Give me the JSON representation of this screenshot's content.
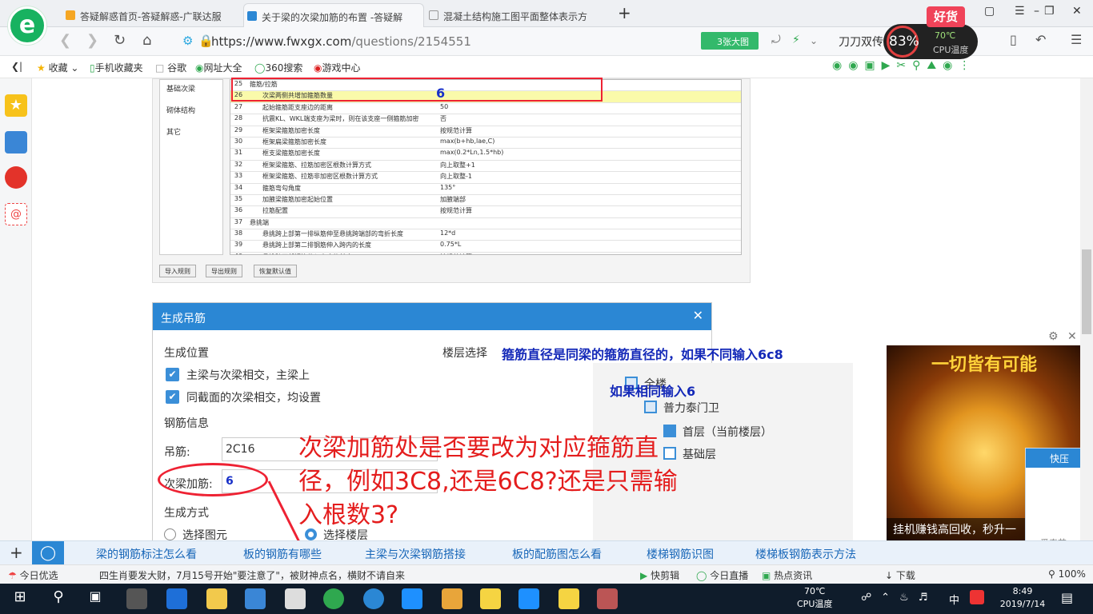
{
  "tabs": [
    {
      "label": "答疑解惑首页-答疑解惑-广联达服",
      "active": false
    },
    {
      "label": "关于梁的次梁加筋的布置 -答疑解",
      "active": true
    },
    {
      "label": "混凝土结构施工图平面整体表示方",
      "active": false
    }
  ],
  "window": {
    "new_tab": "+"
  },
  "hot_badge": "好货",
  "cpu": {
    "percent": "83%",
    "temp": "70℃",
    "label": "CPU温度"
  },
  "address": {
    "host": "https://www.fwxgx.com",
    "path": "/questions/2154551",
    "big_image_button": "3张大图",
    "search_hint": "刀刀双传"
  },
  "bookmarks": [
    "收藏",
    "手机收藏夹",
    "谷歌",
    "网址大全",
    "360搜索",
    "游戏中心"
  ],
  "doc": {
    "left_items": [
      "基础次梁",
      "砌体结构",
      "其它"
    ],
    "rows": [
      {
        "n": "25",
        "k": "箍筋/拉筋",
        "v": "",
        "group": true
      },
      {
        "n": "26",
        "k": "次梁两侧共增加箍筋数量",
        "v": "",
        "highlight": true
      },
      {
        "n": "27",
        "k": "起始箍筋距支座边的距离",
        "v": "50"
      },
      {
        "n": "28",
        "k": "抗震KL、WKL端支座为梁时，则在该支座一侧箍筋加密",
        "v": "否"
      },
      {
        "n": "29",
        "k": "框架梁箍筋加密长度",
        "v": "按规范计算"
      },
      {
        "n": "30",
        "k": "框架扁梁箍筋加密长度",
        "v": "max(b+hb,lae,C)"
      },
      {
        "n": "31",
        "k": "框支梁箍筋加密长度",
        "v": "max(0.2*Ln,1.5*hb)"
      },
      {
        "n": "32",
        "k": "框架梁箍筋、拉筋加密区根数计算方式",
        "v": "向上取整+1"
      },
      {
        "n": "33",
        "k": "框架梁箍筋、拉筋非加密区根数计算方式",
        "v": "向上取整-1"
      },
      {
        "n": "34",
        "k": "箍筋弯勾角度",
        "v": "135°"
      },
      {
        "n": "35",
        "k": "加腋梁箍筋加密起始位置",
        "v": "加腋端部"
      },
      {
        "n": "36",
        "k": "拉筋配置",
        "v": "按规范计算"
      },
      {
        "n": "37",
        "k": "悬挑端",
        "v": "",
        "group": true
      },
      {
        "n": "38",
        "k": "悬挑跨上部第一排纵筋伸至悬挑跨端部的弯折长度",
        "v": "12*d"
      },
      {
        "n": "39",
        "k": "悬挑跨上部第二排钢筋伸入跨内的长度",
        "v": "0.75*L"
      },
      {
        "n": "40",
        "k": "悬挑跨下部钢筋伸入支座的长度",
        "v": "按规范计算"
      }
    ],
    "buttons": [
      "导入规则",
      "导出规则",
      "恢复默认值"
    ],
    "six_mark": "6"
  },
  "dialog": {
    "title": "生成吊筋",
    "close": "✕",
    "pos_title": "生成位置",
    "cb1": "主梁与次梁相交，主梁上",
    "cb2": "同截面的次梁相交，均设置",
    "info_title": "钢筋信息",
    "hanger_label": "吊筋:",
    "hanger_value": "2C16",
    "sec_label": "次梁加筋:",
    "sec_value": "6",
    "method_title": "生成方式",
    "radio1": "选择图元",
    "radio2": "选择楼层",
    "floor_title": "楼层选择",
    "tree": [
      "全楼",
      "普力泰门卫",
      "首层（当前楼层）",
      "基础层"
    ]
  },
  "annotations": {
    "a1": "箍筋直径是同梁的箍筋直径的，如果不同输入6c8",
    "a2": "如果相同输入6",
    "question": "次梁加筋处是否要改为对应箍筋直径，例如3C8,还是6C8?还是只需输入根数3?"
  },
  "ad": {
    "title": "一切皆有可能",
    "caption": "挂机赚钱高回收，秒升一"
  },
  "kuaiya": {
    "title": "快压",
    "footer": "爱奇艺"
  },
  "links": [
    "梁的钢筋标注怎么看",
    "板的钢筋有哪些",
    "主梁与次梁钢筋搭接",
    "板的配筋图怎么看",
    "楼梯钢筋识图",
    "楼梯板钢筋表示方法"
  ],
  "status": {
    "today": "今日优选",
    "news": "四生肖要发大财，7月15号开始\"要注意了\"，被财神点名，横财不请自来",
    "items": [
      "快剪辑",
      "今日直播",
      "热点资讯",
      "下载",
      "100%"
    ]
  },
  "taskbar": {
    "temp": "70℃",
    "temp_label": "CPU温度",
    "ime": "中",
    "time": "8:49",
    "date": "2019/7/14"
  }
}
